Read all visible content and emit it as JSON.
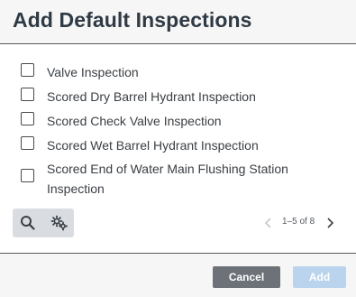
{
  "dialog": {
    "title": "Add Default Inspections"
  },
  "items": [
    {
      "label": "Valve Inspection",
      "checked": false
    },
    {
      "label": "Scored Dry Barrel Hydrant Inspection",
      "checked": false
    },
    {
      "label": "Scored Check Valve Inspection",
      "checked": false
    },
    {
      "label": "Scored Wet Barrel Hydrant Inspection",
      "checked": false
    },
    {
      "label": "Scored End of Water Main Flushing Station Inspection",
      "checked": false
    }
  ],
  "toolbar": {
    "search_icon": "search-icon",
    "settings_icon": "gears-icon"
  },
  "pager": {
    "range": "1–5 of 8"
  },
  "footer": {
    "cancel_label": "Cancel",
    "add_label": "Add"
  },
  "colors": {
    "cancel_bg": "#6c7277",
    "add_bg_disabled": "#b9d4ec",
    "header_text": "#2f3a44"
  }
}
